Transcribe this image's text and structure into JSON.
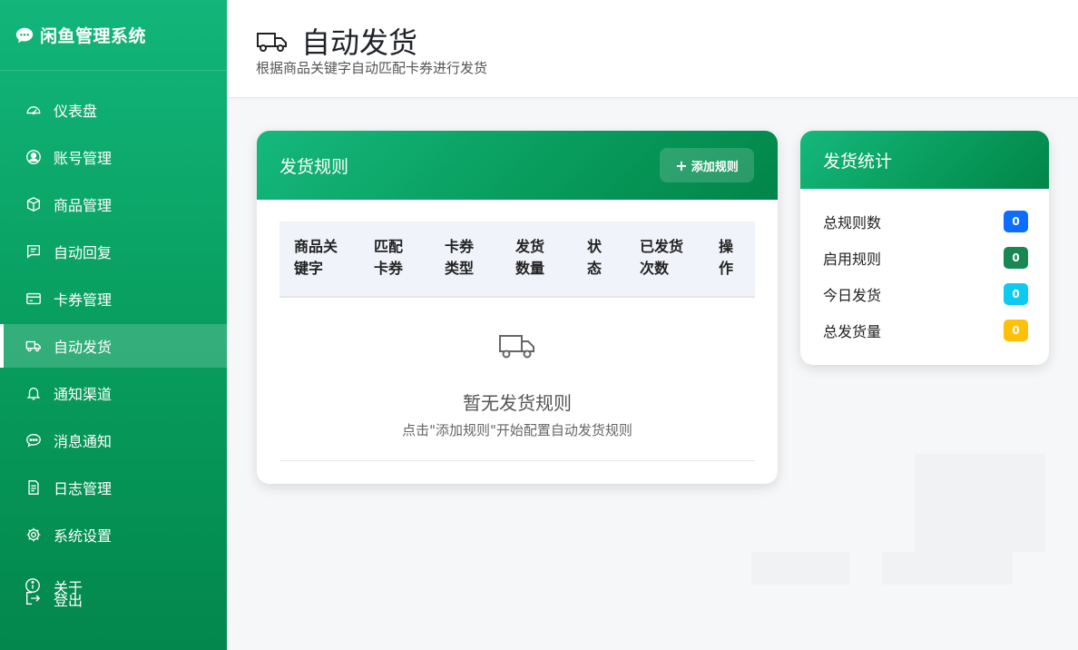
{
  "brand": {
    "name": "闲鱼管理系统",
    "icon": "chat-bubble-icon"
  },
  "sidebar": {
    "items": [
      {
        "label": "仪表盘",
        "icon": "speedometer-icon",
        "active": false
      },
      {
        "label": "账号管理",
        "icon": "user-circle-icon",
        "active": false
      },
      {
        "label": "商品管理",
        "icon": "box-icon",
        "active": false
      },
      {
        "label": "自动回复",
        "icon": "message-square-icon",
        "active": false
      },
      {
        "label": "卡券管理",
        "icon": "card-icon",
        "active": false
      },
      {
        "label": "自动发货",
        "icon": "truck-icon",
        "active": true
      },
      {
        "label": "通知渠道",
        "icon": "bell-icon",
        "active": false
      },
      {
        "label": "消息通知",
        "icon": "chat-dots-icon",
        "active": false
      },
      {
        "label": "日志管理",
        "icon": "document-icon",
        "active": false
      },
      {
        "label": "系统设置",
        "icon": "gear-icon",
        "active": false
      }
    ],
    "about_label": "关于",
    "logout_label": "登出"
  },
  "header": {
    "title": "自动发货",
    "subtitle": "根据商品关键字自动匹配卡券进行发货",
    "icon": "truck-icon"
  },
  "rules": {
    "title": "发货规则",
    "add_button": "添加规则",
    "columns": [
      [
        "商品关",
        "键字"
      ],
      [
        "匹配",
        "卡券"
      ],
      [
        "卡券",
        "类型"
      ],
      [
        "发货",
        "数量"
      ],
      [
        "状",
        "态"
      ],
      [
        "已发货",
        "次数"
      ],
      [
        "操",
        "作"
      ]
    ],
    "empty_title": "暂无发货规则",
    "empty_hint": "点击\"添加规则\"开始配置自动发货规则"
  },
  "stats": {
    "title": "发货统计",
    "rows": [
      {
        "label": "总规则数",
        "value": "0",
        "color": "#0d6efd"
      },
      {
        "label": "启用规则",
        "value": "0",
        "color": "#198754"
      },
      {
        "label": "今日发货",
        "value": "0",
        "color": "#0dcaf0"
      },
      {
        "label": "总发货量",
        "value": "0",
        "color": "#ffc107"
      }
    ]
  }
}
